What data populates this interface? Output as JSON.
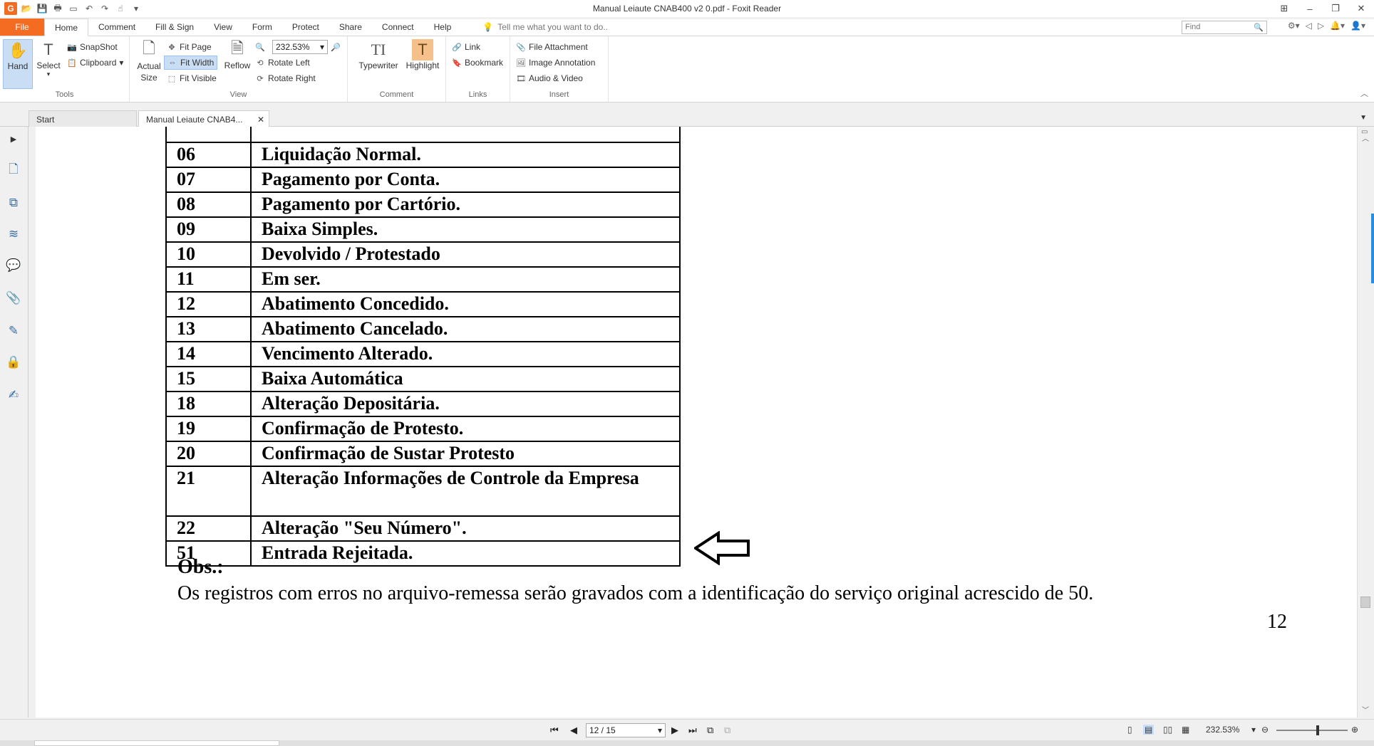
{
  "window": {
    "title": "Manual Leiaute CNAB400 v2 0.pdf - Foxit Reader"
  },
  "menu": {
    "file": "File",
    "tabs": [
      "Home",
      "Comment",
      "Fill & Sign",
      "View",
      "Form",
      "Protect",
      "Share",
      "Connect",
      "Help"
    ],
    "tell_me": "Tell me what you want to do..",
    "find_placeholder": "Find"
  },
  "ribbon": {
    "tools": {
      "label": "Tools",
      "hand": "Hand",
      "select": "Select",
      "snapshot": "SnapShot",
      "clipboard": "Clipboard"
    },
    "view": {
      "label": "View",
      "actual_size": "Actual Size",
      "fit_page": "Fit Page",
      "fit_width": "Fit Width",
      "fit_visible": "Fit Visible",
      "reflow": "Reflow",
      "zoom_value": "232.53%",
      "rotate_left": "Rotate Left",
      "rotate_right": "Rotate Right"
    },
    "comment": {
      "label": "Comment",
      "typewriter": "Typewriter",
      "highlight": "Highlight"
    },
    "links": {
      "label": "Links",
      "link": "Link",
      "bookmark": "Bookmark"
    },
    "insert": {
      "label": "Insert",
      "file_attachment": "File Attachment",
      "image_annotation": "Image Annotation",
      "audio_video": "Audio & Video"
    }
  },
  "doc_tabs": {
    "start": "Start",
    "current": "Manual Leiaute CNAB4..."
  },
  "document": {
    "rows": [
      {
        "code": "06",
        "desc": "Liquidação Normal."
      },
      {
        "code": "07",
        "desc": "Pagamento por Conta."
      },
      {
        "code": "08",
        "desc": "Pagamento por Cartório."
      },
      {
        "code": "09",
        "desc": "Baixa Simples."
      },
      {
        "code": "10",
        "desc": "Devolvido / Protestado"
      },
      {
        "code": "11",
        "desc": "Em ser."
      },
      {
        "code": "12",
        "desc": "Abatimento Concedido."
      },
      {
        "code": "13",
        "desc": "Abatimento Cancelado."
      },
      {
        "code": "14",
        "desc": "Vencimento Alterado."
      },
      {
        "code": "15",
        "desc": "Baixa Automática"
      },
      {
        "code": "18",
        "desc": "Alteração Depositária."
      },
      {
        "code": "19",
        "desc": "Confirmação de Protesto."
      },
      {
        "code": "20",
        "desc": "Confirmação de Sustar Protesto"
      },
      {
        "code": "21",
        "desc": "Alteração Informações de Controle da Empresa"
      },
      {
        "code": "22",
        "desc": "Alteração \"Seu Número\"."
      },
      {
        "code": "51",
        "desc": "Entrada Rejeitada."
      }
    ],
    "obs_title": "Obs.:",
    "obs_text": "Os registros com erros no arquivo-remessa serão gravados com a identificação do serviço original acrescido de 50.",
    "page_number": "12"
  },
  "status": {
    "page_indicator": "12 / 15",
    "zoom": "232.53%"
  }
}
